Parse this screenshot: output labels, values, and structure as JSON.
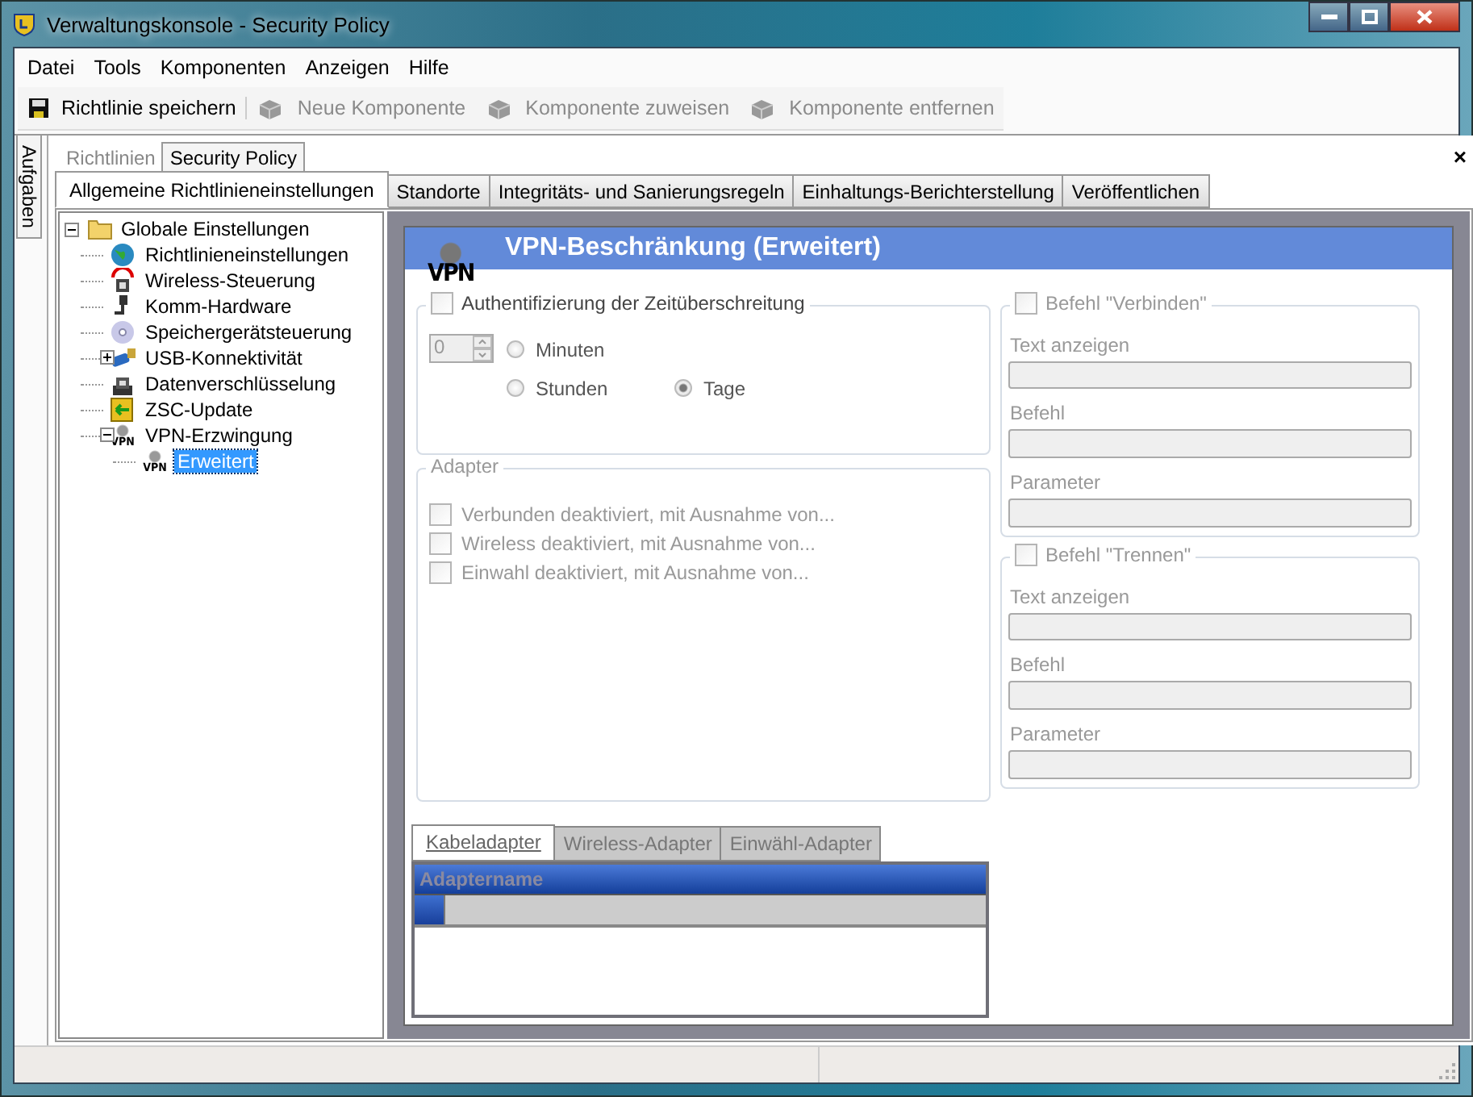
{
  "window": {
    "title": "Verwaltungskonsole - Security Policy"
  },
  "menu": [
    "Datei",
    "Tools",
    "Komponenten",
    "Anzeigen",
    "Hilfe"
  ],
  "toolbar": [
    {
      "label": "Richtlinie speichern",
      "disabled": false
    },
    {
      "label": "Neue Komponente",
      "disabled": true
    },
    {
      "label": "Komponente zuweisen",
      "disabled": true
    },
    {
      "label": "Komponente entfernen",
      "disabled": true
    }
  ],
  "side_tab": "Aufgaben",
  "breadcrumb": [
    {
      "label": "Richtlinien",
      "selected": false
    },
    {
      "label": "Security Policy",
      "selected": true
    }
  ],
  "close_symbol": "×",
  "tabs": [
    {
      "label": "Allgemeine Richtlinieneinstellungen",
      "selected": true
    },
    {
      "label": "Standorte",
      "selected": false
    },
    {
      "label": "Integritäts- und Sanierungsregeln",
      "selected": false
    },
    {
      "label": "Einhaltungs-Berichterstellung",
      "selected": false
    },
    {
      "label": "Veröffentlichen",
      "selected": false
    }
  ],
  "tree": [
    {
      "label": "Globale Einstellungen",
      "expanded": true,
      "selected": false,
      "children": [
        {
          "label": "Richtlinieneinstellungen",
          "selected": false
        },
        {
          "label": "Wireless-Steuerung",
          "selected": false
        },
        {
          "label": "Komm-Hardware",
          "selected": false
        },
        {
          "label": "Speichergerätsteuerung",
          "selected": false
        },
        {
          "label": "USB-Konnektivität",
          "expanded": false,
          "selected": false
        },
        {
          "label": "Datenverschlüsselung",
          "selected": false
        },
        {
          "label": "ZSC-Update",
          "selected": false
        },
        {
          "label": "VPN-Erzwingung",
          "expanded": true,
          "selected": false,
          "icon_label": "VPN",
          "children": [
            {
              "label": "Erweitert",
              "selected": true,
              "icon_label": "VPN"
            }
          ]
        }
      ]
    }
  ],
  "panel": {
    "title": "VPN-Beschränkung (Erweitert)",
    "icon_label": "VPN",
    "timeout": {
      "label": "Authentifizierung der Zeitüberschreitung",
      "checked": false,
      "spin_value": "0",
      "radios": [
        {
          "label": "Minuten",
          "selected": false
        },
        {
          "label": "Stunden",
          "selected": false
        },
        {
          "label": "Tage",
          "selected": true
        }
      ]
    },
    "adapter": {
      "title": "Adapter",
      "options": [
        {
          "label": "Verbunden deaktiviert, mit Ausnahme von...",
          "checked": false
        },
        {
          "label": "Wireless deaktiviert, mit Ausnahme von...",
          "checked": false
        },
        {
          "label": "Einwahl deaktiviert, mit Ausnahme von...",
          "checked": false
        }
      ]
    },
    "commands": [
      {
        "label": "Befehl \"Verbinden\"",
        "checked": false,
        "fields": [
          "Text anzeigen",
          "Befehl",
          "Parameter"
        ]
      },
      {
        "label": "Befehl \"Trennen\"",
        "checked": false,
        "fields": [
          "Text anzeigen",
          "Befehl",
          "Parameter"
        ]
      }
    ],
    "adapter_tabs": [
      {
        "label": "Kabeladapter",
        "selected": true
      },
      {
        "label": "Wireless-Adapter",
        "selected": false
      },
      {
        "label": "Einwähl-Adapter",
        "selected": false
      }
    ],
    "grid": {
      "column": "Adaptername"
    }
  }
}
